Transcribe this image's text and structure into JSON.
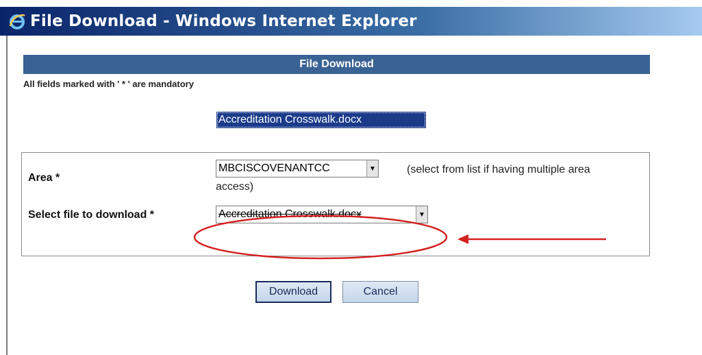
{
  "window": {
    "title": "File Download - Windows Internet Explorer",
    "icon": "internet-explorer-icon"
  },
  "form": {
    "header": "File Download",
    "mandatory_note": "All fields marked with ' * ' are mandatory",
    "area": {
      "label": "Area *",
      "selected": "MBCISCOVENANTCC",
      "helper_line1": "(select from list if having multiple area",
      "helper_line2": "access)"
    },
    "file": {
      "label": "Select file to download *",
      "selected": "Accreditation Crosswalk.docx",
      "options": [
        "Accreditation Crosswalk.docx"
      ]
    },
    "buttons": {
      "download": "Download",
      "cancel": "Cancel"
    }
  },
  "colors": {
    "header_bar": "#3a6394",
    "title_bar": "#0a246a",
    "annotation_red": "#d42020",
    "selection": "#1b3b8a"
  }
}
